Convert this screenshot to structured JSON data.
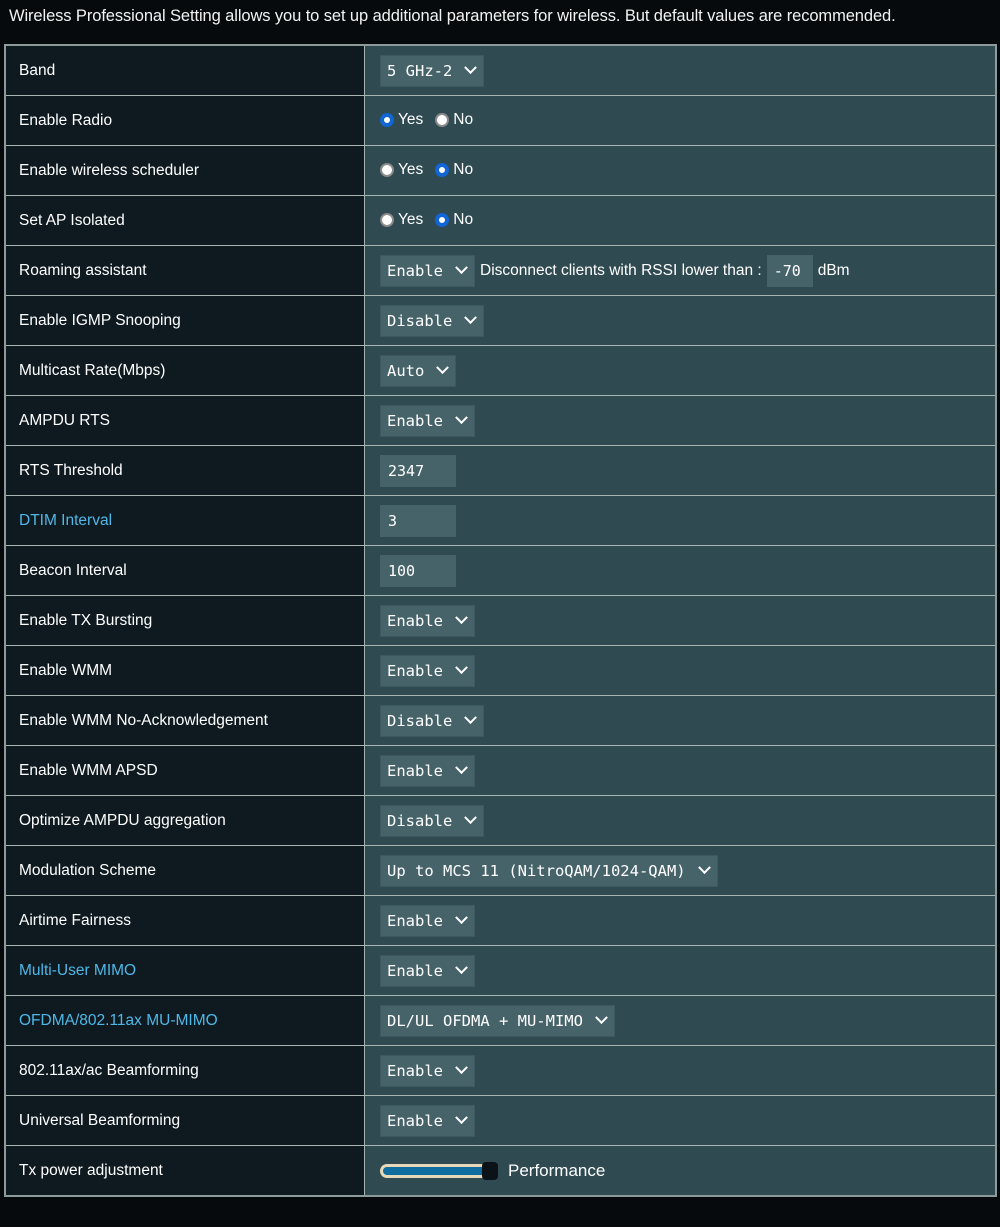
{
  "description": "Wireless Professional Setting allows you to set up additional parameters for wireless. But default values are recommended.",
  "rows": [
    {
      "label": "Band",
      "type": "select",
      "value": "5 GHz-2",
      "link": false
    },
    {
      "label": "Enable Radio",
      "type": "radio",
      "options": [
        "Yes",
        "No"
      ],
      "selected": "Yes",
      "link": false
    },
    {
      "label": "Enable wireless scheduler",
      "type": "radio",
      "options": [
        "Yes",
        "No"
      ],
      "selected": "No",
      "link": false
    },
    {
      "label": "Set AP Isolated",
      "type": "radio",
      "options": [
        "Yes",
        "No"
      ],
      "selected": "No",
      "link": false
    },
    {
      "label": "Roaming assistant",
      "type": "roaming",
      "value": "Enable",
      "text": "Disconnect clients with RSSI lower than :",
      "rssi": "-70",
      "unit": "dBm",
      "link": false
    },
    {
      "label": "Enable IGMP Snooping",
      "type": "select",
      "value": "Disable",
      "link": false
    },
    {
      "label": "Multicast Rate(Mbps)",
      "type": "select",
      "value": "Auto",
      "link": false
    },
    {
      "label": "AMPDU RTS",
      "type": "select",
      "value": "Enable",
      "link": false
    },
    {
      "label": "RTS Threshold",
      "type": "input",
      "value": "2347",
      "link": false
    },
    {
      "label": "DTIM Interval",
      "type": "input",
      "value": "3",
      "link": true
    },
    {
      "label": "Beacon Interval",
      "type": "input",
      "value": "100",
      "link": false
    },
    {
      "label": "Enable TX Bursting",
      "type": "select",
      "value": "Enable",
      "link": false
    },
    {
      "label": "Enable WMM",
      "type": "select",
      "value": "Enable",
      "link": false
    },
    {
      "label": "Enable WMM No-Acknowledgement",
      "type": "select",
      "value": "Disable",
      "link": false
    },
    {
      "label": "Enable WMM APSD",
      "type": "select",
      "value": "Enable",
      "link": false
    },
    {
      "label": "Optimize AMPDU aggregation",
      "type": "select",
      "value": "Disable",
      "link": false
    },
    {
      "label": "Modulation Scheme",
      "type": "select",
      "value": "Up to MCS 11 (NitroQAM/1024-QAM)",
      "link": false
    },
    {
      "label": "Airtime Fairness",
      "type": "select",
      "value": "Enable",
      "link": false
    },
    {
      "label": "Multi-User MIMO",
      "type": "select",
      "value": "Enable",
      "link": true
    },
    {
      "label": "OFDMA/802.11ax MU-MIMO",
      "type": "select",
      "value": "DL/UL OFDMA + MU-MIMO",
      "link": true
    },
    {
      "label": "802.11ax/ac Beamforming",
      "type": "select",
      "value": "Enable",
      "link": false
    },
    {
      "label": "Universal Beamforming",
      "type": "select",
      "value": "Enable",
      "link": false
    },
    {
      "label": "Tx power adjustment",
      "type": "slider",
      "value": "Performance",
      "level": 1.0,
      "link": false
    }
  ],
  "colors": {
    "link": "#4fb8e8",
    "radio_selected": "#1265d4",
    "slider_fill": "#0f6e9f"
  }
}
